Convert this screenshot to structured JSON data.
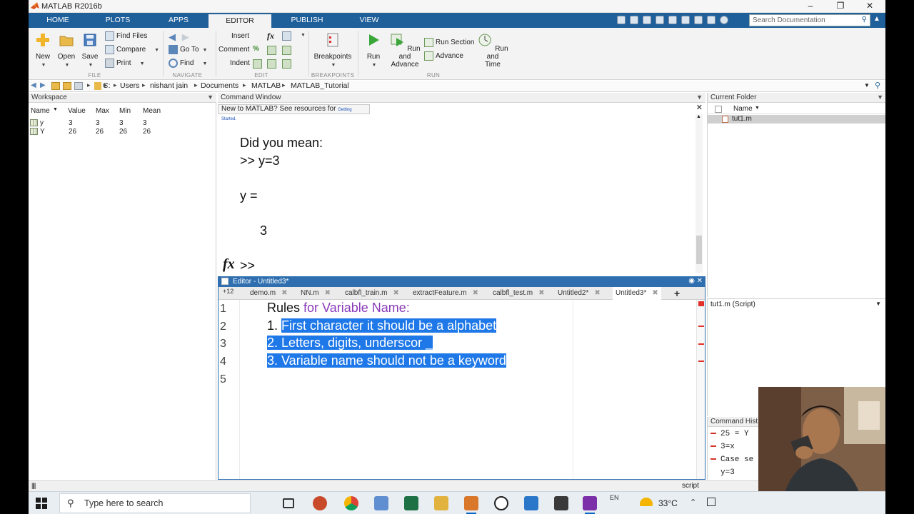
{
  "window": {
    "title": "MATLAB R2016b",
    "minimize": "–",
    "restore": "❐",
    "close": "✕"
  },
  "ribbon_tabs": [
    "HOME",
    "PLOTS",
    "APPS",
    "EDITOR",
    "PUBLISH",
    "VIEW"
  ],
  "doc_search": {
    "placeholder": "Search Documentation"
  },
  "ribbon": {
    "file": {
      "new": "New",
      "open": "Open",
      "save": "Save",
      "find_files": "Find Files",
      "compare": "Compare",
      "print": "Print",
      "label": "FILE"
    },
    "navigate": {
      "go_to": "Go To",
      "find": "Find",
      "label": "NAVIGATE"
    },
    "edit": {
      "insert": "Insert",
      "comment": "Comment",
      "indent": "Indent",
      "fx": "fx",
      "comment_glyph": "%",
      "label": "EDIT"
    },
    "breakpoints": {
      "breakpoints": "Breakpoints",
      "label": "BREAKPOINTS"
    },
    "run": {
      "run": "Run",
      "run_and_advance_1": "Run and",
      "run_and_advance_2": "Advance",
      "run_section": "Run Section",
      "advance": "Advance",
      "run_and_time_1": "Run and",
      "run_and_time_2": "Time",
      "label": "RUN"
    }
  },
  "address": {
    "drive": "C:",
    "parts": [
      "Users",
      "nishant jain",
      "Documents",
      "MATLAB",
      "MATLAB_Tutorial"
    ]
  },
  "workspace": {
    "title": "Workspace",
    "columns": [
      "Name",
      "Value",
      "Max",
      "Min",
      "Mean"
    ],
    "rows": [
      {
        "name": "y",
        "value": "3",
        "max": "3",
        "min": "3",
        "mean": "3"
      },
      {
        "name": "Y",
        "value": "26",
        "max": "26",
        "min": "26",
        "mean": "26"
      }
    ]
  },
  "command_window": {
    "title": "Command Window",
    "banner": "New to MATLAB? See resources for",
    "banner_link": "Getting Started.",
    "lines": [
      "Did you mean:",
      ">> y=3",
      "y =",
      "3",
      ">>"
    ],
    "prompt_icon": "fx"
  },
  "editor": {
    "title": "Editor - Untitled3*",
    "tab_prefix": "+12",
    "tabs": [
      "demo.m",
      "NN.m",
      "calbfl_train.m",
      "extractFeature.m",
      "calbfl_test.m",
      "Untitled2*",
      "Untitled3*"
    ],
    "add_tab": "+",
    "line_numbers": [
      "1",
      "2",
      "3",
      "4",
      "5"
    ],
    "code": {
      "line1_a": "Rules ",
      "line1_b": "for Variable Name",
      "line1_c": ":",
      "line2_a": "1. ",
      "line2_b": "First character it should be a alphabet",
      "line3": "2. Letters, digits, underscor _",
      "line4": "3. Variable name should not be a keyword"
    }
  },
  "current_folder": {
    "title": "Current Folder",
    "column": "Name",
    "files": [
      "tut1.m"
    ]
  },
  "details": {
    "label": "tut1.m  (Script)"
  },
  "command_history": {
    "title": "Command Hist",
    "lines": [
      "25 = Y",
      "3=x",
      "Case se",
      "y=3"
    ]
  },
  "status": {
    "text": "script"
  },
  "taskbar": {
    "search_placeholder": "Type here to search",
    "lang": "EN",
    "temperature": "33°C"
  },
  "colors": {
    "ribbon_blue": "#1f5f9a",
    "selection": "#1e78e8",
    "keyword_purple": "#8a3ab9",
    "error_red": "#e0302a"
  }
}
